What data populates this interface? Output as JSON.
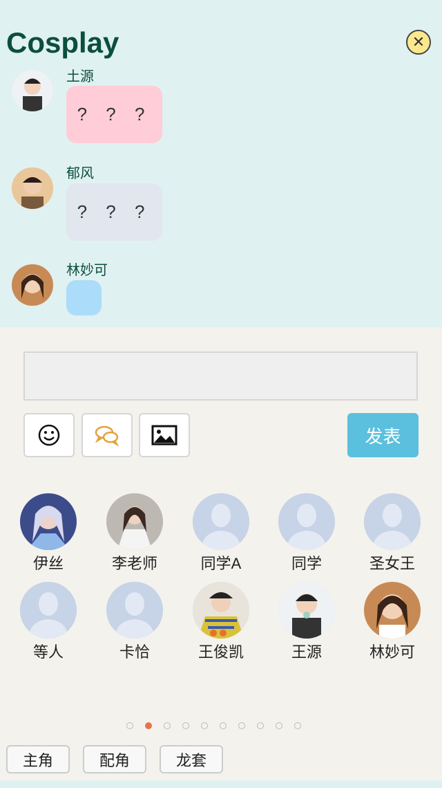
{
  "header": {
    "title": "Cosplay",
    "close_icon": "close-icon"
  },
  "messages": [
    {
      "sender": "土源",
      "text": "? ? ?",
      "bubble_color": "#ffcdd8"
    },
    {
      "sender": "郁风",
      "text": "? ? ?",
      "bubble_color": "#e1e6ef"
    },
    {
      "sender": "林妙可",
      "text": "",
      "bubble_color": "#abdcfa"
    }
  ],
  "composer": {
    "input_value": "",
    "tools": [
      "smiley-icon",
      "chat-bubbles-icon",
      "image-icon"
    ],
    "send_label": "发表"
  },
  "members": [
    {
      "name": "伊丝"
    },
    {
      "name": "李老师"
    },
    {
      "name": "同学A"
    },
    {
      "name": "同学"
    },
    {
      "name": "圣女王"
    },
    {
      "name": "等人"
    },
    {
      "name": "卡恰"
    },
    {
      "name": "王俊凯"
    },
    {
      "name": "王源"
    },
    {
      "name": "林妙可"
    }
  ],
  "pager": {
    "total": 10,
    "current": 2
  },
  "roles": [
    "主角",
    "配角",
    "龙套"
  ],
  "colors": {
    "accent": "#5bc0de",
    "title": "#0b4f3c",
    "active_dot": "#e8734a"
  }
}
